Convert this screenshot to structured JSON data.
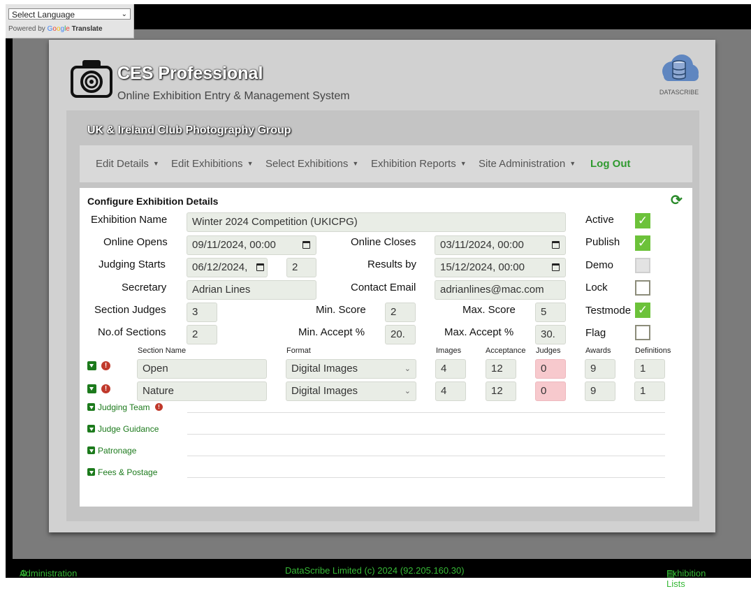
{
  "translate": {
    "select_label": "Select Language",
    "powered_by": "Powered by",
    "translate_word": "Translate"
  },
  "header": {
    "title": "CES Professional",
    "subtitle": "Online Exhibition Entry & Management System",
    "logo_text": "DATASCRIBE"
  },
  "org_name": "UK & Ireland Club Photography Group",
  "nav": {
    "items": [
      "Edit Details",
      "Edit Exhibitions",
      "Select Exhibitions",
      "Exhibition Reports",
      "Site Administration"
    ],
    "logout": "Log Out"
  },
  "panel": {
    "title": "Configure Exhibition Details",
    "labels": {
      "exhibition_name": "Exhibition Name",
      "online_opens": "Online Opens",
      "online_closes": "Online Closes",
      "judging_starts": "Judging Starts",
      "results_by": "Results by",
      "secretary": "Secretary",
      "contact_email": "Contact Email",
      "section_judges": "Section Judges",
      "min_score": "Min. Score",
      "max_score": "Max. Score",
      "no_of_sections": "No.of Sections",
      "min_accept": "Min. Accept %",
      "max_accept": "Max. Accept %"
    },
    "values": {
      "exhibition_name": "Winter 2024 Competition (UKICPG)",
      "online_opens": "09/11/2024, 00:00",
      "online_closes": "03/11/2024, 00:00",
      "judging_starts": "06/12/2024,",
      "judging_days": "2",
      "results_by": "15/12/2024, 00:00",
      "secretary": "Adrian Lines",
      "contact_email": "adrianlines@mac.com",
      "section_judges": "3",
      "min_score": "2",
      "max_score": "5",
      "no_of_sections": "2",
      "min_accept": "20.",
      "max_accept": "30."
    },
    "flags": {
      "active": "Active",
      "publish": "Publish",
      "demo": "Demo",
      "lock": "Lock",
      "testmode": "Testmode",
      "flag": "Flag"
    },
    "flag_states": {
      "active": true,
      "publish": true,
      "demo": "disabled",
      "lock": false,
      "testmode": true,
      "flag": false
    },
    "section_headers": {
      "section_name": "Section Name",
      "format": "Format",
      "images": "Images",
      "acceptance": "Acceptance",
      "judges": "Judges",
      "awards": "Awards",
      "definitions": "Definitions"
    },
    "sections": [
      {
        "name": "Open",
        "format": "Digital Images",
        "images": "4",
        "acceptance": "12",
        "judges": "0",
        "awards": "9",
        "definitions": "1"
      },
      {
        "name": "Nature",
        "format": "Digital Images",
        "images": "4",
        "acceptance": "12",
        "judges": "0",
        "awards": "9",
        "definitions": "1"
      }
    ],
    "accordions": [
      "Judging Team",
      "Judge Guidance",
      "Patronage",
      "Fees & Postage"
    ]
  },
  "footer": {
    "left": "Administration",
    "center": "DataScribe Limited (c) 2024 (92.205.160.30)",
    "right": "Exhibition Lists"
  },
  "colors": {
    "accent_green": "#6cc23a",
    "link_green": "#1c7a1c",
    "error_red": "#c0392b",
    "judges_pink": "#f7c9cd"
  }
}
